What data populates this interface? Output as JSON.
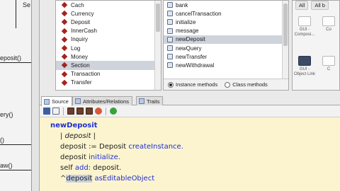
{
  "diagram": {
    "labels": [
      "Se",
      "eposit()",
      "ery()",
      "()",
      "aw()"
    ]
  },
  "classes": {
    "items": [
      "Cach",
      "Currency",
      "Deposit",
      "InnerCash",
      "Inquiry",
      "Log",
      "Money",
      "Section",
      "Transaction",
      "Transfer"
    ],
    "selected_index": 7
  },
  "methods": {
    "items": [
      "bank",
      "cancelTransaction",
      "initialize",
      "message",
      "newDeposit",
      "newQuery",
      "newTransfer",
      "newWithdrawal"
    ],
    "selected_index": 4,
    "footer": {
      "instance_label": "Instance methods",
      "class_label": "Class methods",
      "mode": "instance"
    }
  },
  "plugins": {
    "tabs": [
      "All",
      "All b"
    ],
    "items": [
      "GUI - Composi...",
      "GUI - Object Link",
      "Co",
      "C"
    ]
  },
  "tabs": [
    {
      "label": "Source",
      "active": true
    },
    {
      "label": "Attributes/Relations",
      "active": false
    },
    {
      "label": "Traits",
      "active": false
    }
  ],
  "code": {
    "method_name": "newDeposit",
    "temps": "| deposit |",
    "line2_var": "deposit",
    "line2_assign": ":=",
    "line2_class": "Deposit",
    "line2_msg": "createInstance.",
    "line3_var": "deposit",
    "line3_msg": "initialize.",
    "line4_recv": "self",
    "line4_msg": "add:",
    "line4_arg": "deposit.",
    "line5_caret": "^",
    "line5_var": "deposit",
    "line5_msg": "asEditableObject"
  },
  "colors": {
    "editor_bg": "#fbf4cf",
    "keyword": "#1d2fd0",
    "class_icon": "#a4231f",
    "selection": "#cfd3dc"
  }
}
